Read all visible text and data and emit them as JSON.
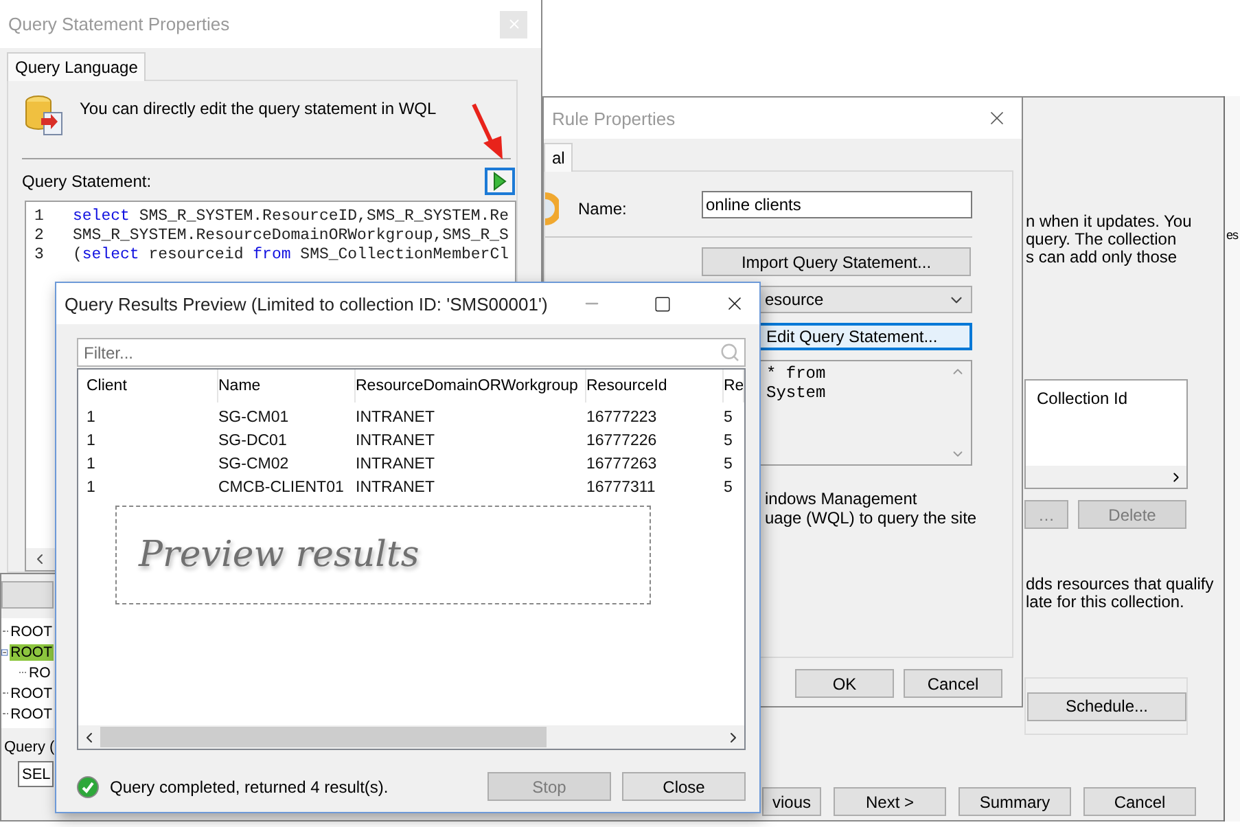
{
  "background_window": {
    "tree": [
      {
        "label": "ROOT",
        "selected": false
      },
      {
        "label": "ROOT",
        "selected": true,
        "expanded": true,
        "children": [
          {
            "label": "RO",
            "selected": false
          }
        ]
      },
      {
        "label": "ROOT",
        "selected": false
      },
      {
        "label": "ROOT",
        "selected": false
      }
    ],
    "query_label": "Query (",
    "query_field": "SEL",
    "side_label": "es",
    "intro_lines": [
      "n when it updates. You",
      "query. The collection",
      "s can add only those"
    ],
    "list_column": "Collection Id",
    "list_buttons": [
      {
        "label": "…",
        "disabled": true
      },
      {
        "label": "Delete",
        "disabled": true
      }
    ],
    "info_lines": [
      "dds resources that qualify",
      "late for this collection."
    ],
    "schedule_button": "Schedule...",
    "nav_buttons": [
      {
        "label": "vious"
      },
      {
        "label": "Next >"
      },
      {
        "label": "Summary"
      },
      {
        "label": "Cancel"
      }
    ]
  },
  "query_statement_window": {
    "title": "Query Statement Properties",
    "tabs": [
      {
        "label": "Query Language",
        "selected": true
      }
    ],
    "intro": "You can directly edit the query statement in WQL",
    "statement_label": "Query Statement:",
    "code_lines": [
      {
        "number": "1",
        "segments": [
          {
            "kind": "keyword",
            "text": "select"
          },
          {
            "kind": "plain",
            "text": " SMS_R_SYSTEM.ResourceID,SMS_R_SYSTEM.Re"
          }
        ]
      },
      {
        "number": "2",
        "segments": [
          {
            "kind": "plain",
            "text": "SMS_R_SYSTEM.ResourceDomainORWorkgroup,SMS_R_S"
          }
        ]
      },
      {
        "number": "3",
        "segments": [
          {
            "kind": "plain",
            "text": "("
          },
          {
            "kind": "keyword",
            "text": "select"
          },
          {
            "kind": "plain",
            "text": " resourceid "
          },
          {
            "kind": "keyword",
            "text": "from"
          },
          {
            "kind": "plain",
            "text": " SMS_CollectionMemberCl"
          }
        ]
      }
    ]
  },
  "rule_window": {
    "title": "Rule Properties",
    "tabs": [
      {
        "label": "al",
        "selected": true
      }
    ],
    "name_label": "Name:",
    "name_value": "online clients",
    "import_button": "Import Query Statement...",
    "resource_class": "esource",
    "edit_button": "Edit Query Statement...",
    "query_preview": [
      "* from",
      "System"
    ],
    "description_lines": [
      "indows Management",
      "uage (WQL) to query the site"
    ],
    "buttons": [
      "OK",
      "Cancel"
    ]
  },
  "results_window": {
    "title": "Query Results Preview (Limited to collection ID: 'SMS00001')",
    "filter": {
      "placeholder": "Filter..."
    },
    "columns": [
      "Client",
      "Name",
      "ResourceDomainORWorkgroup",
      "ResourceId",
      "Re"
    ],
    "rows": [
      [
        "1",
        "SG-CM01",
        "INTRANET",
        "16777223",
        "5"
      ],
      [
        "1",
        "SG-DC01",
        "INTRANET",
        "16777226",
        "5"
      ],
      [
        "1",
        "SG-CM02",
        "INTRANET",
        "16777263",
        "5"
      ],
      [
        "1",
        "CMCB-CLIENT01",
        "INTRANET",
        "16777311",
        "5"
      ]
    ],
    "annotation": "Preview results",
    "status": "Query completed, returned 4 result(s).",
    "buttons": [
      {
        "label": "Stop",
        "disabled": true
      },
      {
        "label": "Close",
        "disabled": false
      }
    ]
  }
}
